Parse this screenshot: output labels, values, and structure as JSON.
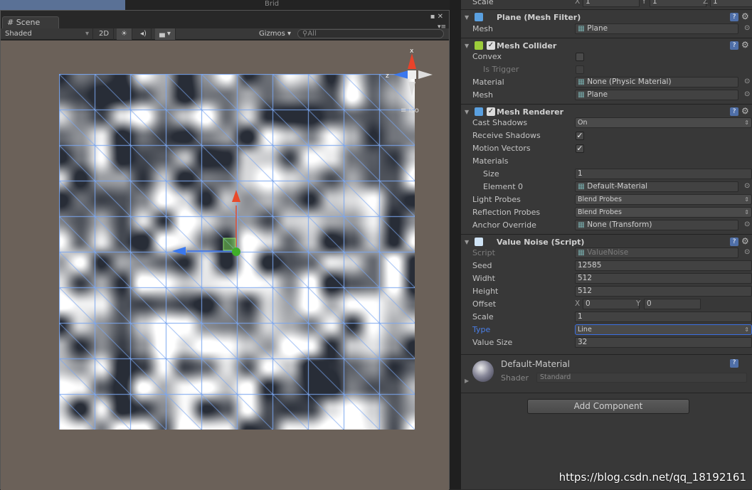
{
  "background": {
    "brid_label": "Brid"
  },
  "scene": {
    "tab_label": "Scene",
    "toolbar": {
      "shading_mode": "Shaded",
      "mode_2d": "2D",
      "gizmos": "Gizmos",
      "search_placeholder": "All"
    },
    "gizmo": {
      "x_label": "x",
      "z_label": "z",
      "projection": "Iso"
    },
    "grid_cells": 10,
    "wire_color": "#7aa6f0"
  },
  "inspector": {
    "scale_row": {
      "label": "Scale",
      "x": "1",
      "y": "1",
      "z": "1"
    },
    "rows": [
      {
        "kind": "header",
        "label": "Plane (Mesh Filter)",
        "icon": "mesh-filter-icon",
        "icon_color": "#5aa0e0"
      },
      {
        "kind": "object",
        "label": "Mesh",
        "value": "Plane"
      },
      {
        "kind": "header",
        "label": "Mesh Collider",
        "icon": "mesh-collider-icon",
        "icon_color": "#9ccc3a",
        "checked": true
      },
      {
        "kind": "check",
        "label": "Convex",
        "checked": false
      },
      {
        "kind": "check",
        "label": "Is Trigger",
        "checked": false,
        "dim": true,
        "indent": true
      },
      {
        "kind": "object",
        "label": "Material",
        "value": "None (Physic Material)"
      },
      {
        "kind": "object",
        "label": "Mesh",
        "value": "Plane"
      },
      {
        "kind": "header",
        "label": "Mesh Renderer",
        "icon": "mesh-renderer-icon",
        "icon_color": "#5aa0e0",
        "checked": true
      },
      {
        "kind": "dropdown",
        "label": "Cast Shadows",
        "value": "On"
      },
      {
        "kind": "check",
        "label": "Receive Shadows",
        "checked": true
      },
      {
        "kind": "check",
        "label": "Motion Vectors",
        "checked": true
      },
      {
        "kind": "text",
        "label": "Materials"
      },
      {
        "kind": "field",
        "label": "Size",
        "value": "1",
        "indent": true
      },
      {
        "kind": "object",
        "label": "Element 0",
        "value": "Default-Material",
        "indent": true
      },
      {
        "kind": "dropdown",
        "label": "Light Probes",
        "value": "Blend Probes"
      },
      {
        "kind": "dropdown",
        "label": "Reflection Probes",
        "value": "Blend Probes"
      },
      {
        "kind": "object",
        "label": "Anchor Override",
        "value": "None (Transform)"
      },
      {
        "kind": "header",
        "label": "Value Noise (Script)",
        "icon": "csharp-script-icon",
        "icon_color": "#cfe3f5"
      },
      {
        "kind": "object",
        "label": "Script",
        "value": "ValueNoise",
        "dim": true
      },
      {
        "kind": "field",
        "label": "Seed",
        "value": "12585"
      },
      {
        "kind": "field",
        "label": "Widht",
        "value": "512"
      },
      {
        "kind": "field",
        "label": "Height",
        "value": "512"
      },
      {
        "kind": "xy",
        "label": "Offset",
        "x": "0",
        "y": "0"
      },
      {
        "kind": "field",
        "label": "Scale",
        "value": "1"
      },
      {
        "kind": "dropdown",
        "label": "Type",
        "value": "Line",
        "focused": true
      },
      {
        "kind": "field",
        "label": "Value Size",
        "value": "32"
      }
    ],
    "material": {
      "name": "Default-Material",
      "shader_label": "Shader",
      "shader_value": "Standard"
    },
    "add_component": "Add Component"
  },
  "watermark": "https://blog.csdn.net/qq_18192161"
}
